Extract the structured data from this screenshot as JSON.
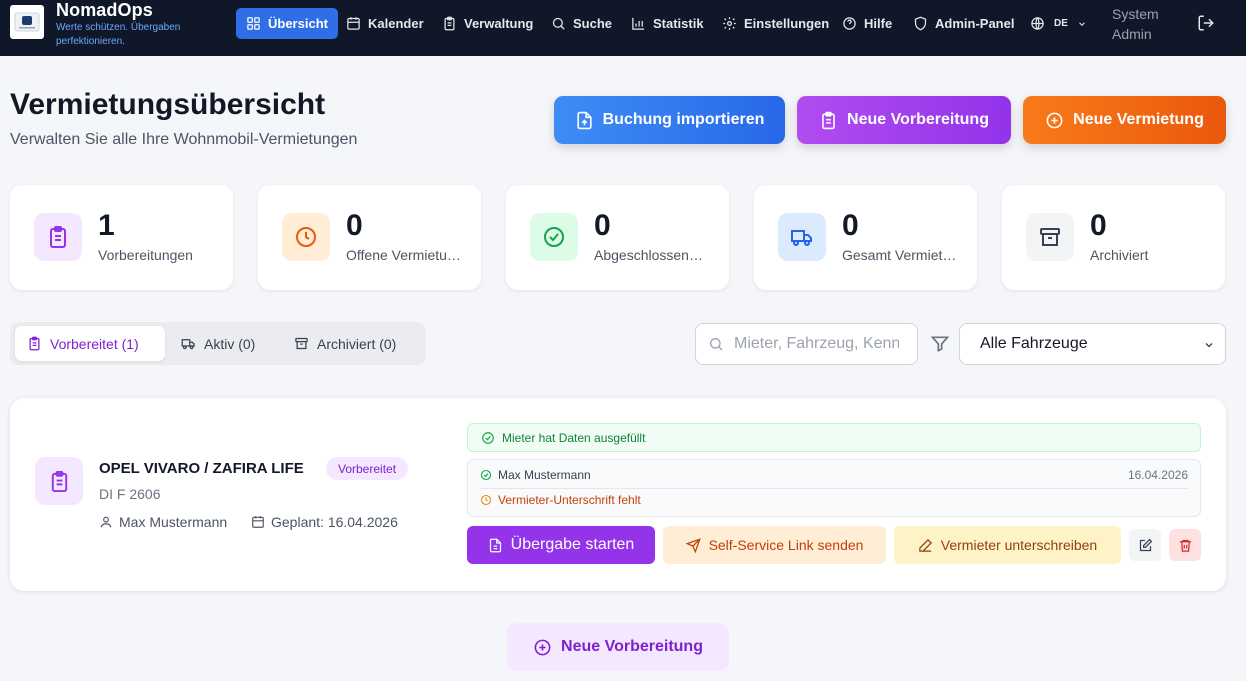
{
  "app": {
    "name": "NomadOps",
    "tagline": "Werte schützen. Übergaben perfektionieren."
  },
  "nav": {
    "items": [
      {
        "label": "Übersicht",
        "icon": "grid-icon",
        "active": true
      },
      {
        "label": "Kalender",
        "icon": "calendar-icon"
      },
      {
        "label": "Verwaltung",
        "icon": "clipboard-icon"
      },
      {
        "label": "Suche",
        "icon": "search-icon"
      },
      {
        "label": "Statistik",
        "icon": "bar-chart-icon"
      },
      {
        "label": "Einstellungen",
        "icon": "gear-icon"
      },
      {
        "label": "Hilfe",
        "icon": "help-circle-icon"
      },
      {
        "label": "Admin-Panel",
        "icon": "shield-icon"
      }
    ],
    "language": "DE",
    "user": "System Admin"
  },
  "header": {
    "title": "Vermietungsübersicht",
    "subtitle": "Verwalten Sie alle Ihre Wohnmobil-Vermietungen",
    "buttons": {
      "import": "Buchung importieren",
      "new_prep": "Neue Vorbereitung",
      "new_rental": "Neue Vermietung"
    }
  },
  "stats": [
    {
      "value": "1",
      "label": "Vorbereitungen",
      "icon": "clipboard-icon",
      "color": "#9333ea"
    },
    {
      "value": "0",
      "label": "Offene Vermietungen",
      "icon": "clock-icon",
      "color": "#ea580c"
    },
    {
      "value": "0",
      "label": "Abgeschlossene Vermietungen",
      "icon": "check-circle-icon",
      "color": "#16a34a"
    },
    {
      "value": "0",
      "label": "Gesamt Vermietungen",
      "icon": "truck-icon",
      "color": "#2563eb"
    },
    {
      "value": "0",
      "label": "Archiviert",
      "icon": "archive-icon",
      "color": "#4b5563"
    }
  ],
  "tabs": [
    {
      "label": "Vorbereitet (1)",
      "active": true
    },
    {
      "label": "Aktiv (0)"
    },
    {
      "label": "Archiviert (0)"
    }
  ],
  "filters": {
    "search_placeholder": "Mieter, Fahrzeug, Kennzeichen",
    "vehicle_select": "Alle Fahrzeuge"
  },
  "rental": {
    "vehicle": "OPEL VIVARO / ZAFIRA LIFE",
    "status": "Vorbereitet",
    "plate": "DI F 2606",
    "customer": "Max Mustermann",
    "planned": "Geplant: 16.04.2026",
    "tenant_status": "Mieter hat Daten ausgefüllt",
    "signature_name": "Max Mustermann",
    "signature_date": "16.04.2026",
    "signature_missing": "Vermieter-Unterschrift fehlt",
    "actions": {
      "start": "Übergabe starten",
      "send_link": "Self-Service Link senden",
      "sign": "Vermieter unterschreiben"
    }
  },
  "bottom_button": "Neue Vorbereitung"
}
